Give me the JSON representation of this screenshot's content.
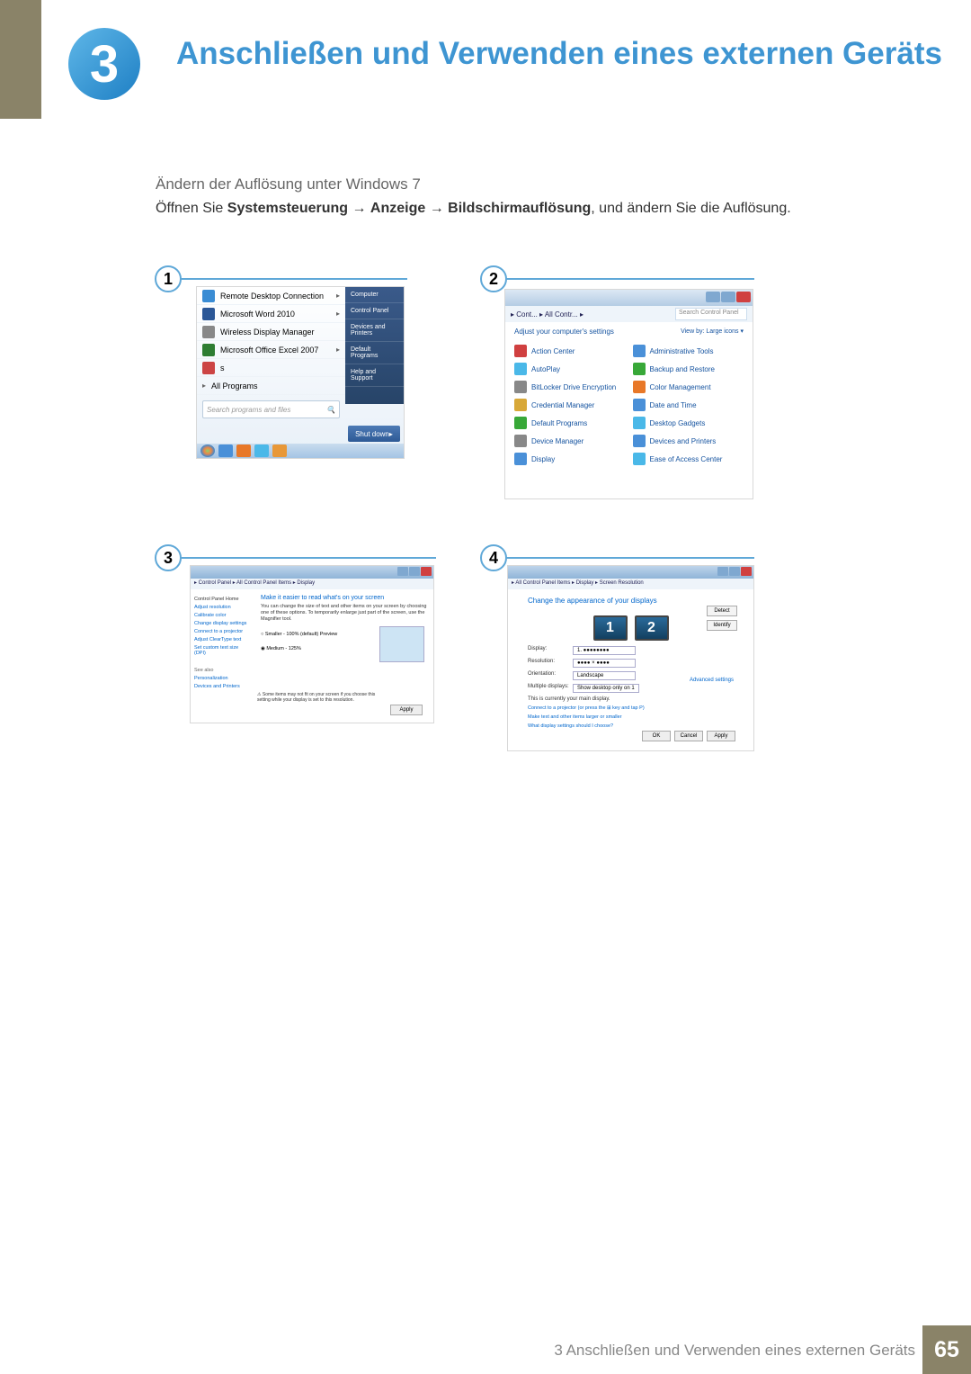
{
  "chapter": {
    "number": "3",
    "title": "Anschließen und Verwenden eines externen Geräts"
  },
  "subhead": "Ändern der Auflösung unter Windows 7",
  "body": {
    "prefix": "Öffnen Sie ",
    "b1": "Systemsteuerung",
    "arrow": " → ",
    "b2": "Anzeige",
    "b3": "Bildschirmauflösung",
    "suffix": ", und ändern Sie die Auflösung."
  },
  "step": {
    "s1": "1",
    "s2": "2",
    "s3": "3",
    "s4": "4"
  },
  "fig1": {
    "items": [
      "Remote Desktop Connection",
      "Microsoft Word 2010",
      "Wireless Display Manager",
      "Microsoft Office Excel 2007",
      "s",
      "All Programs"
    ],
    "right": [
      "Computer",
      "Control Panel",
      "Devices and Printers",
      "Default Programs",
      "Help and Support"
    ],
    "search": "Search programs and files",
    "shutdown": "Shut down"
  },
  "fig2": {
    "breadcrumb": "▸ Cont... ▸ All Contr... ▸",
    "search": "Search Control Panel",
    "heading": "Adjust your computer's settings",
    "view": "View by:   Large icons ▾",
    "items": [
      "Action Center",
      "Administrative Tools",
      "AutoPlay",
      "Backup and Restore",
      "BitLocker Drive Encryption",
      "Color Management",
      "Credential Manager",
      "Date and Time",
      "Default Programs",
      "Desktop Gadgets",
      "Device Manager",
      "Devices and Printers",
      "Display",
      "Ease of Access Center"
    ]
  },
  "fig3": {
    "breadcrumb": "▸ Control Panel ▸ All Control Panel Items ▸ Display",
    "title": "Make it easier to read what's on your screen",
    "body": "You can change the size of text and other items on your screen by choosing one of these options. To temporarily enlarge just part of the screen, use the Magnifier tool.",
    "opt1": "Smaller - 100% (default)     Preview",
    "opt2": "Medium - 125%",
    "warn": "⚠ Some items may not fit on your screen if you choose this setting while your display is set to this resolution.",
    "side": [
      "Control Panel Home",
      "Adjust resolution",
      "Calibrate color",
      "Change display settings",
      "Connect to a projector",
      "Adjust ClearType text",
      "Set custom text size (DPI)",
      "",
      "See also",
      "Personalization",
      "Devices and Printers"
    ],
    "apply": "Apply"
  },
  "fig4": {
    "breadcrumb": "▸ All Control Panel Items ▸ Display ▸ Screen Resolution",
    "title": "Change the appearance of your displays",
    "detect": "Detect",
    "identify": "Identify",
    "m1": "1",
    "m2": "2",
    "rows": [
      {
        "label": "Display:",
        "value": "1. ●●●●●●●●"
      },
      {
        "label": "Resolution:",
        "value": "●●●● × ●●●●"
      },
      {
        "label": "Orientation:",
        "value": "Landscape"
      },
      {
        "label": "Multiple displays:",
        "value": "Show desktop only on 1"
      }
    ],
    "current": "This is currently your main display.",
    "adv": "Advanced settings",
    "link1": "Connect to a projector (or press the ⊞ key and tap P)",
    "link2": "Make text and other items larger or smaller",
    "link3": "What display settings should I choose?",
    "ok": "OK",
    "cancel": "Cancel",
    "applyb": "Apply"
  },
  "footer": {
    "text": "3 Anschließen und Verwenden eines externen Geräts",
    "page": "65"
  }
}
